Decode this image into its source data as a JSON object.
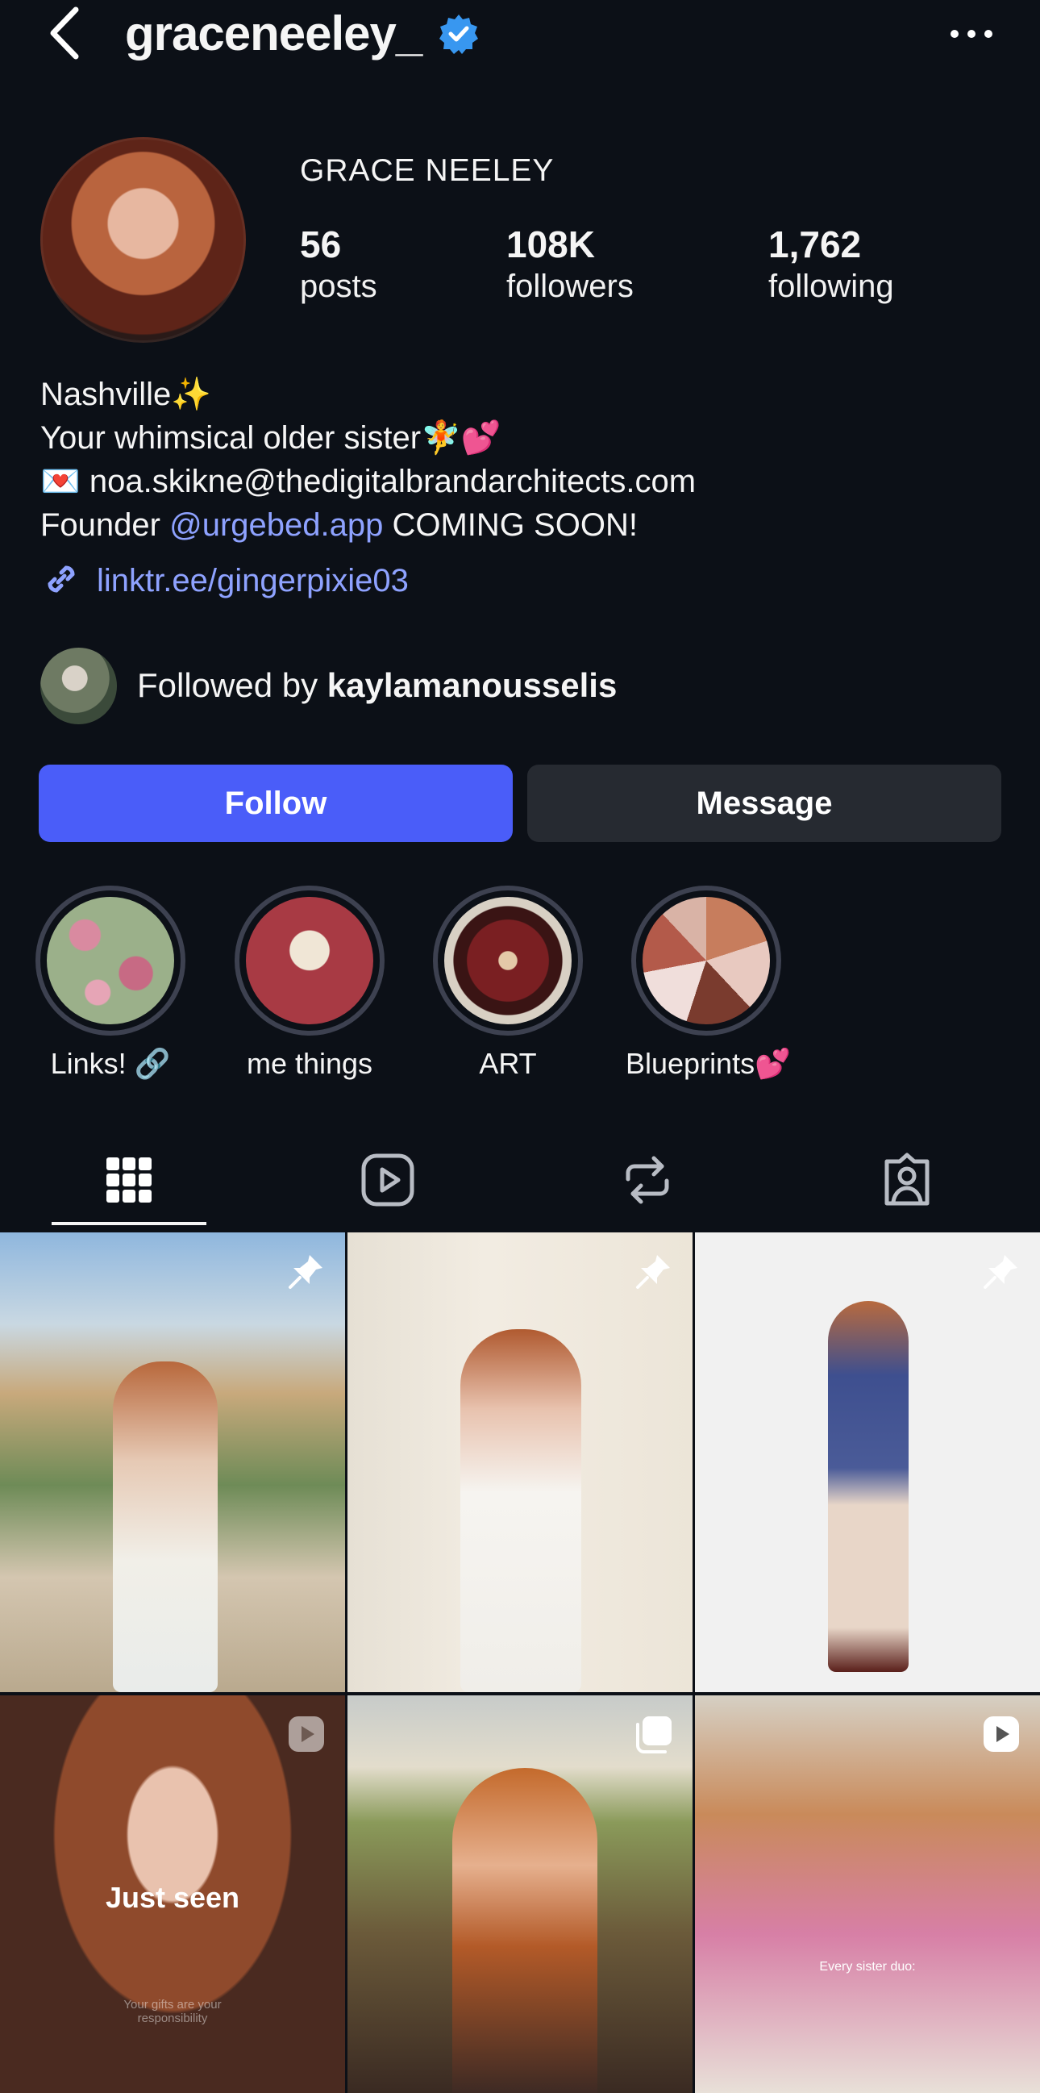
{
  "header": {
    "username": "graceneeley_",
    "back_icon": "chevron-left-icon",
    "verified_icon": "verified-badge-icon",
    "more_icon": "more-horizontal-icon"
  },
  "profile": {
    "full_name": "GRACE NEELEY",
    "stats": [
      {
        "value": "56",
        "label": "posts"
      },
      {
        "value": "108K",
        "label": "followers"
      },
      {
        "value": "1,762",
        "label": "following"
      }
    ],
    "bio": {
      "line1": "Nashville✨",
      "line2": "Your whimsical older sister🧚💕",
      "line3": "💌 noa.skikne@thedigitalbrandarchitects.com",
      "line4_prefix": "Founder ",
      "line4_mention": "@urgebed.app",
      "line4_suffix": " COMING SOON!"
    },
    "link": "linktr.ee/gingerpixie03",
    "followed_by_prefix": "Followed by ",
    "followed_by_user": "kaylamanousselis"
  },
  "actions": {
    "follow_label": "Follow",
    "message_label": "Message"
  },
  "highlights": [
    {
      "label": "Links! 🔗"
    },
    {
      "label": "me things"
    },
    {
      "label": "ART"
    },
    {
      "label": "Blueprints💕"
    }
  ],
  "tabs": [
    {
      "icon": "grid-icon",
      "active": true
    },
    {
      "icon": "reels-icon",
      "active": false
    },
    {
      "icon": "reposts-icon",
      "active": false
    },
    {
      "icon": "tagged-icon",
      "active": false
    }
  ],
  "posts": [
    {
      "badge": "pin-icon"
    },
    {
      "badge": "pin-icon"
    },
    {
      "badge": "pin-icon"
    },
    {
      "badge": "reel-icon",
      "overlay_text": "Just seen",
      "overlay_subtext": "Your gifts are your responsibility"
    },
    {
      "badge": "carousel-icon"
    },
    {
      "badge": "reel-icon",
      "overlay_text": "Every sister duo:"
    }
  ],
  "colors": {
    "background": "#0c1017",
    "accent": "#4a5df9",
    "link": "#8ea2ff",
    "secondary_button": "#262a31",
    "verified": "#3897f0"
  }
}
